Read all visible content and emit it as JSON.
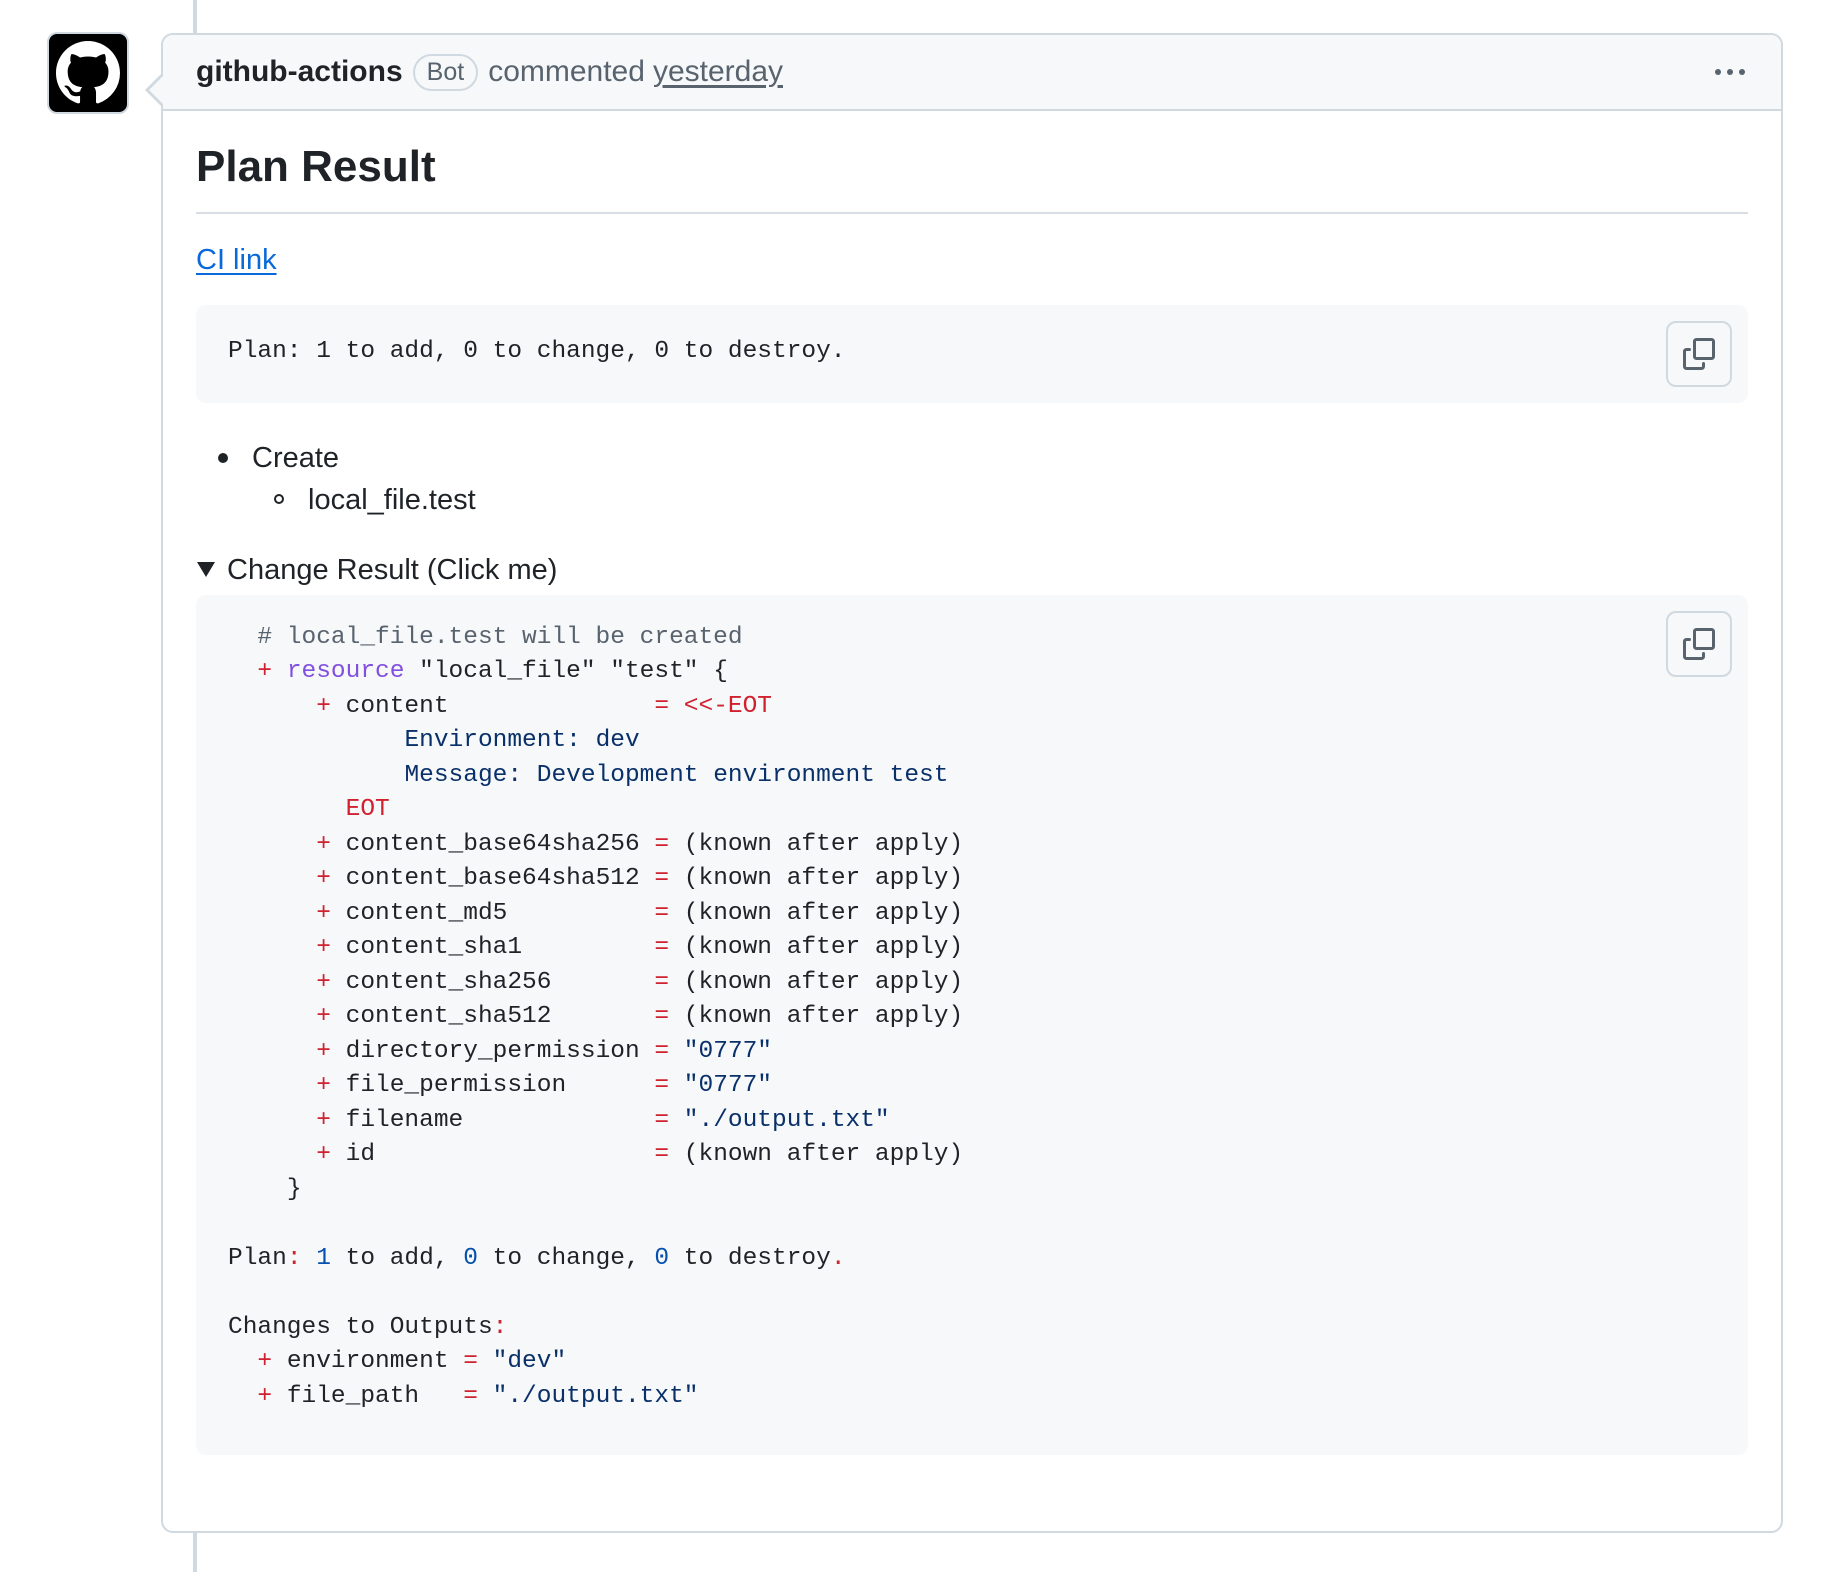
{
  "comment": {
    "author": "github-actions",
    "badge": "Bot",
    "action": "commented",
    "time": "yesterday"
  },
  "body": {
    "title": "Plan Result",
    "ci_link": "CI link",
    "plan_summary": "Plan: 1 to add, 0 to change, 0 to destroy.",
    "list": {
      "item": "Create",
      "subitem": "local_file.test"
    },
    "details_summary": "Change Result (Click me)"
  },
  "code": {
    "comment_line": "# local_file.test will be created",
    "resource_keyword": "resource",
    "resource_rest": " \"local_file\" \"test\" {",
    "plus": "+",
    "eq": "=",
    "content_key": "content              ",
    "heredoc_open": "<<-EOT",
    "heredoc_line1": "Environment: dev",
    "heredoc_line2": "Message: Development environment test",
    "heredoc_close": "EOT",
    "attributes": [
      {
        "key": "content_base64sha256 ",
        "value": "(known after apply)"
      },
      {
        "key": "content_base64sha512 ",
        "value": "(known after apply)"
      },
      {
        "key": "content_md5          ",
        "value": "(known after apply)"
      },
      {
        "key": "content_sha1         ",
        "value": "(known after apply)"
      },
      {
        "key": "content_sha256       ",
        "value": "(known after apply)"
      },
      {
        "key": "content_sha512       ",
        "value": "(known after apply)"
      },
      {
        "key": "directory_permission ",
        "value": "\"0777\""
      },
      {
        "key": "file_permission      ",
        "value": "\"0777\""
      },
      {
        "key": "filename             ",
        "value": "\"./output.txt\""
      },
      {
        "key": "id                   ",
        "value": "(known after apply)"
      }
    ],
    "close_brace": "}",
    "plan_label": "Plan",
    "plan_colon": ":",
    "plan_add_n": "1",
    "plan_add_t": " to add, ",
    "plan_change_n": "0",
    "plan_change_t": " to change, ",
    "plan_destroy_n": "0",
    "plan_destroy_t": " to destroy",
    "plan_dot": ".",
    "outputs_label": "Changes to Outputs",
    "outputs_colon": ":",
    "outputs": [
      {
        "key": "environment ",
        "value": "\"dev\""
      },
      {
        "key": "file_path   ",
        "value": "\"./output.txt\""
      }
    ]
  },
  "icons": {
    "avatar": "github-octocat-icon",
    "menu": "kebab-horizontal-icon",
    "copy": "copy-icon",
    "details": "triangle-down-icon"
  }
}
